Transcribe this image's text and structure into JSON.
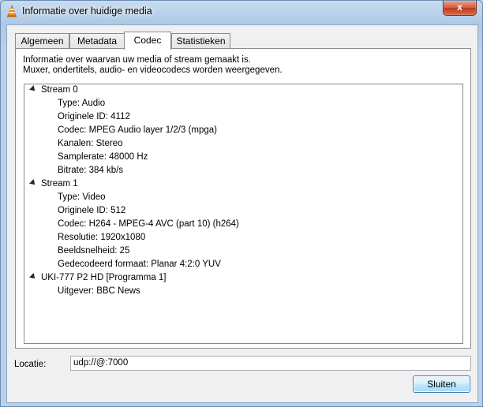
{
  "window": {
    "title": "Informatie over huidige media",
    "close_glyph": "x"
  },
  "tabs": [
    {
      "label": "Algemeen",
      "active": false
    },
    {
      "label": "Metadata",
      "active": false
    },
    {
      "label": "Codec",
      "active": true
    },
    {
      "label": "Statistieken",
      "active": false
    }
  ],
  "description": {
    "line1": "Informatie over waarvan uw media of stream gemaakt is.",
    "line2": "Muxer, ondertitels, audio- en videocodecs worden weergegeven."
  },
  "tree": {
    "stream0": {
      "label": "Stream 0",
      "items": [
        "Type: Audio",
        "Originele ID: 4112",
        "Codec: MPEG Audio layer 1/2/3 (mpga)",
        "Kanalen: Stereo",
        "Samplerate: 48000 Hz",
        "Bitrate: 384 kb/s"
      ]
    },
    "stream1": {
      "label": "Stream 1",
      "items": [
        "Type: Video",
        "Originele ID: 512",
        "Codec: H264 - MPEG-4 AVC (part 10) (h264)",
        "Resolutie: 1920x1080",
        "Beeldsnelheid: 25",
        "Gedecodeerd formaat: Planar 4:2:0 YUV"
      ]
    },
    "program": {
      "label": "UKI-777 P2 HD [Programma 1]",
      "items": [
        "Uitgever: BBC News"
      ]
    }
  },
  "location": {
    "label": "Locatie:",
    "value": "udp://@:7000"
  },
  "buttons": {
    "close": "Sluiten"
  },
  "colors": {
    "frame": "#b9d1ea",
    "close_red": "#c1391a",
    "button_border": "#3c7fb1"
  }
}
